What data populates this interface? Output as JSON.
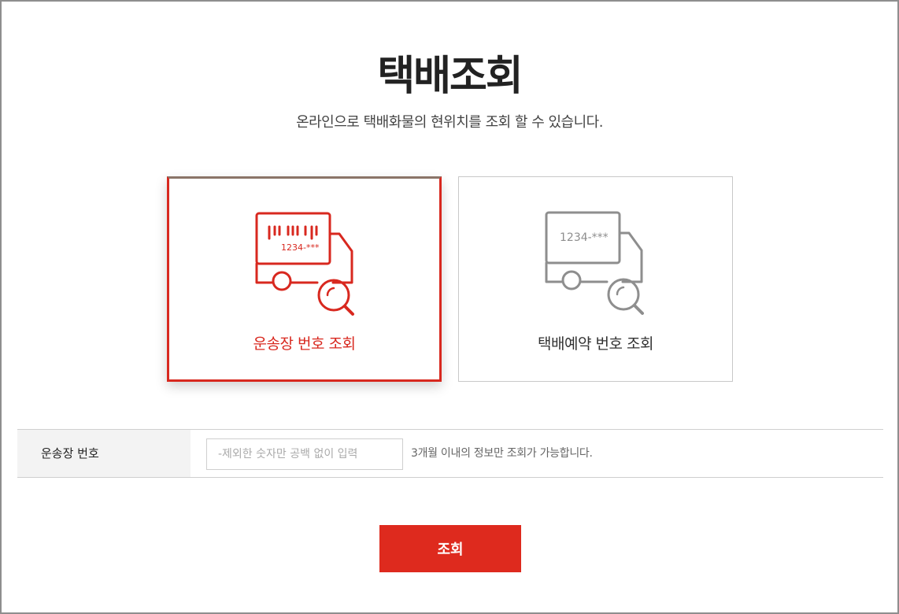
{
  "header": {
    "title": "택배조회",
    "subtitle": "온라인으로 택배화물의 현위치를 조회 할 수 있습니다."
  },
  "cards": [
    {
      "label": "운송장 번호 조회",
      "icon": "truck-barcode-search-icon",
      "badge_text": "1234-***",
      "selected": true
    },
    {
      "label": "택배예약 번호 조회",
      "icon": "truck-search-icon",
      "badge_text": "1234-***",
      "selected": false
    }
  ],
  "form": {
    "label": "운송장 번호",
    "input_value": "",
    "placeholder": "-제외한 숫자만 공백 없이 입력",
    "help": "3개월 이내의 정보만 조회가 가능합니다."
  },
  "submit_label": "조회",
  "colors": {
    "accent": "#de2a1e",
    "inactive_icon": "#8e8e8e"
  }
}
